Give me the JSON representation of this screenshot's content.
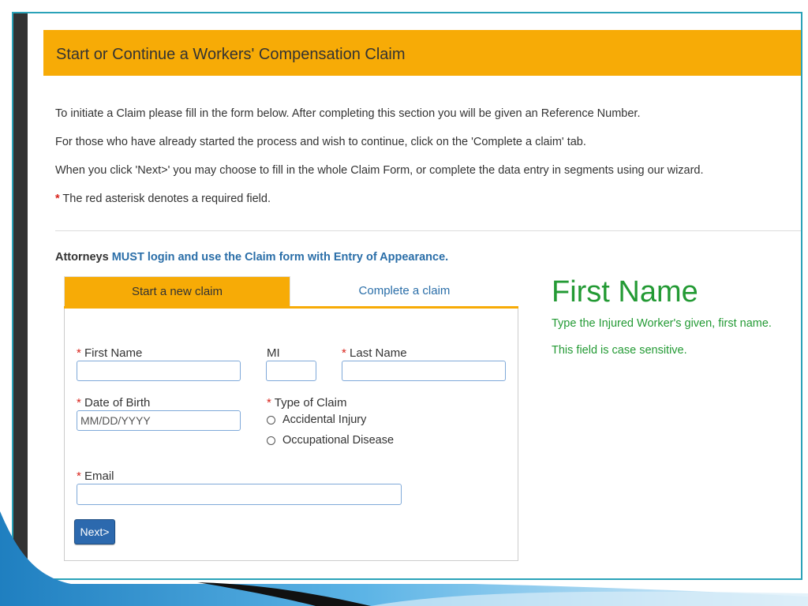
{
  "header": {
    "title": "Start or Continue a Workers' Compensation Claim"
  },
  "intro": {
    "line1": "To initiate a Claim please fill in the form below. After completing this section you will be given an Reference Number.",
    "line2": "For those who have already started the process and wish to continue, click on the 'Complete a claim' tab.",
    "line3": "When you click 'Next>' you may choose to fill in the whole Claim Form, or complete the data entry in segments using our wizard.",
    "required_star": "*",
    "required_note": " The red asterisk denotes a required field."
  },
  "attorney": {
    "prefix": "Attorneys ",
    "emphasis": "MUST login and use the Claim form with Entry of Appearance."
  },
  "tabs": [
    {
      "label": "Start a new claim",
      "active": true
    },
    {
      "label": "Complete a claim",
      "active": false
    }
  ],
  "form": {
    "required_star": "*",
    "first_name": {
      "label": " First Name",
      "value": ""
    },
    "mi": {
      "label": "MI",
      "value": ""
    },
    "last_name": {
      "label": " Last Name",
      "value": ""
    },
    "dob": {
      "label": " Date of Birth",
      "placeholder": "MM/DD/YYYY",
      "value": ""
    },
    "claim_type": {
      "label": " Type of Claim",
      "options": [
        {
          "label": "Accidental Injury",
          "selected": false
        },
        {
          "label": "Occupational Disease",
          "selected": false
        }
      ]
    },
    "email": {
      "label": " Email",
      "value": ""
    },
    "next_label": "Next>"
  },
  "help": {
    "title": "First Name",
    "line1": "Type the Injured Worker's given, first name.",
    "line2": "This field is case sensitive."
  },
  "colors": {
    "header": "#f7ab06",
    "frame": "#2aa2b8",
    "link": "#2a6ea8",
    "help": "#239a34",
    "required": "#d9231b",
    "button": "#2c69ae"
  }
}
